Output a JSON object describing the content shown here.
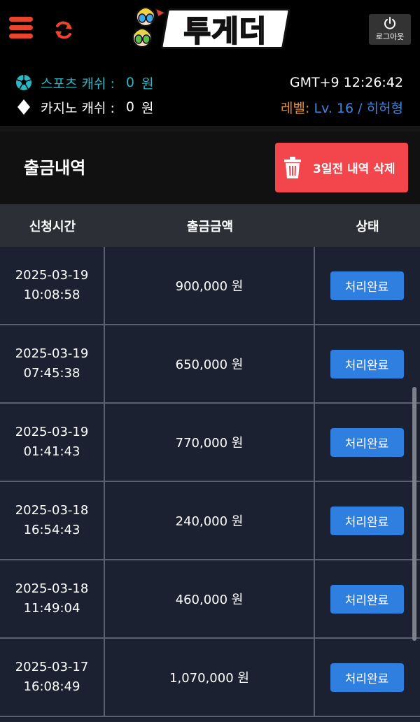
{
  "header": {
    "logo_text": "투게더",
    "logout_label": "로그아웃"
  },
  "info": {
    "sports_label": "스포츠 캐쉬 :",
    "sports_value": "0",
    "casino_label": "카지노 캐쉬 :",
    "casino_value": "0",
    "unit": "원",
    "clock": "GMT+9 12:26:42",
    "level_label": "레벨:",
    "level_value": "Lv. 16 / 히허형"
  },
  "page": {
    "title": "출금내역",
    "delete_button": "3일전 내역 삭제"
  },
  "table": {
    "columns": [
      "신청시간",
      "출금금액",
      "상태"
    ],
    "rows": [
      {
        "date": "2025-03-19",
        "time": "10:08:58",
        "amount": "900,000 원",
        "status": "처리완료"
      },
      {
        "date": "2025-03-19",
        "time": "07:45:38",
        "amount": "650,000 원",
        "status": "처리완료"
      },
      {
        "date": "2025-03-19",
        "time": "01:41:43",
        "amount": "770,000 원",
        "status": "처리완료"
      },
      {
        "date": "2025-03-18",
        "time": "16:54:43",
        "amount": "240,000 원",
        "status": "처리완료"
      },
      {
        "date": "2025-03-18",
        "time": "11:49:04",
        "amount": "460,000 원",
        "status": "처리완료"
      },
      {
        "date": "2025-03-17",
        "time": "16:08:49",
        "amount": "1,070,000 원",
        "status": "처리완료"
      }
    ]
  },
  "colors": {
    "accent_red": "#f2454c",
    "status_blue": "#2f7fe0",
    "sports_teal": "#29b8c4",
    "level_orange": "#e88c2a",
    "level_blue": "#3d86e0"
  },
  "icons": [
    "menu-icon",
    "refresh-icon",
    "power-icon",
    "soccer-ball-icon",
    "diamond-icon",
    "trash-icon"
  ]
}
